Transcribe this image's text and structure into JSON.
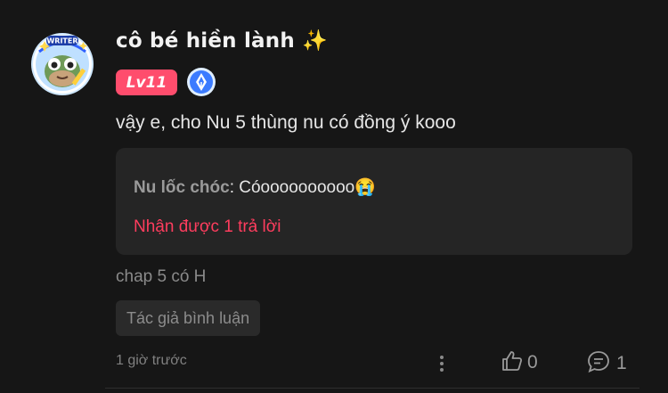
{
  "comment": {
    "username": "cô bé hiền lành",
    "username_sparkle": "✨",
    "level_badge": "Lv11",
    "avatar_badge_text": "WRITER",
    "text": "vậy e, cho Nu 5 thùng nu có đồng ý kooo",
    "quote": {
      "author": "Nu lốc chóc",
      "separator": ": ",
      "text": "Cóoooooooooo😭",
      "replies_link": "Nhận được 1 trả lời"
    },
    "chapter": "chap 5 có H",
    "author_tag": "Tác giả bình luận",
    "timestamp": "1 giờ trước",
    "likes": "0",
    "replies": "1"
  },
  "colors": {
    "background": "#161616",
    "level_badge": "#ff4d6d",
    "replies_link": "#ff3d5e",
    "quote_box": "#252525"
  },
  "icons": [
    "avatar",
    "pen-badge-icon",
    "more-vertical-icon",
    "thumb-up-icon",
    "comment-bubble-icon"
  ]
}
